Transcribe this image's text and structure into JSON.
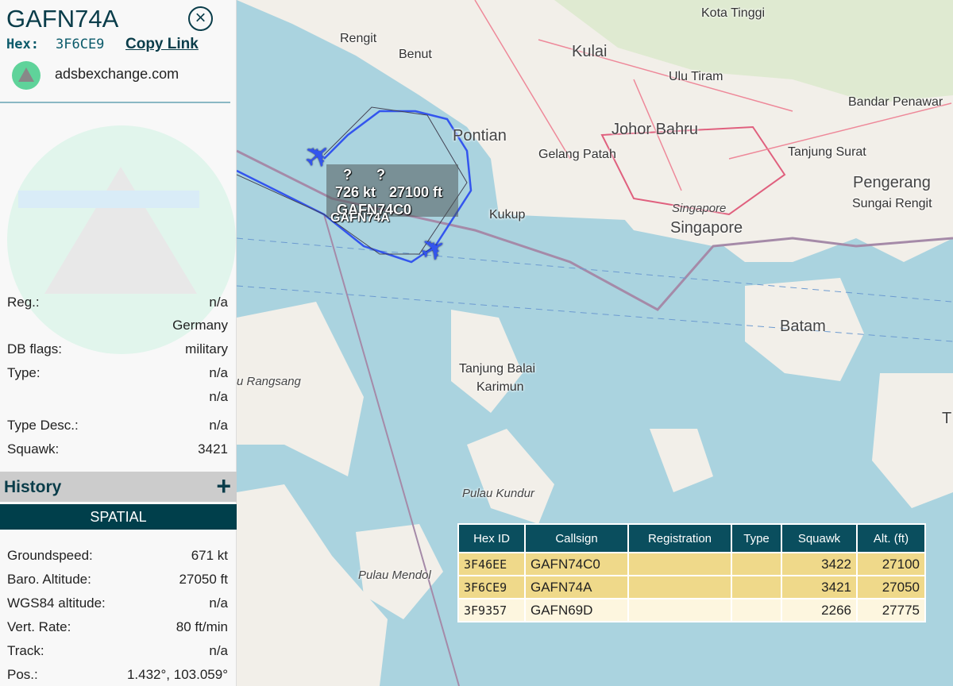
{
  "panel": {
    "callsign": "GAFN74A",
    "hex_label": "Hex:",
    "hex": "3F6CE9",
    "copy_link": "Copy Link",
    "source": "adsbexchange.com",
    "rows1": [
      {
        "k": "Reg.:",
        "v": "n/a"
      },
      {
        "k": "",
        "v": "Germany"
      },
      {
        "k": "DB flags:",
        "v": "military"
      },
      {
        "k": "Type:",
        "v": "n/a"
      },
      {
        "k": "",
        "v": "n/a"
      },
      {
        "k": "Type Desc.:",
        "v": "n/a"
      },
      {
        "k": "Squawk:",
        "v": "3421"
      }
    ],
    "history": "History",
    "history_plus": "+",
    "spatial": "SPATIAL",
    "rows2": [
      {
        "k": "Groundspeed:",
        "v": "671 kt"
      },
      {
        "k": "Baro. Altitude:",
        "v": "27050 ft"
      },
      {
        "k": "WGS84 altitude:",
        "v": "n/a"
      },
      {
        "k": "Vert. Rate:",
        "v": "80 ft/min"
      },
      {
        "k": "Track:",
        "v": "n/a"
      },
      {
        "k": "Pos.:",
        "v": "1.432°, 103.059°"
      }
    ]
  },
  "map": {
    "places": [
      "Kota Tinggi",
      "Rengit",
      "Benut",
      "Kulai",
      "Ulu Tiram",
      "Bandar Penawar",
      "Pontian",
      "Johor Bahru",
      "Gelang Patah",
      "Tanjung Surat",
      "Pengerang",
      "Sungai Rengit",
      "Kukup",
      "Singapore",
      "Singapore",
      "Batam",
      "Tanjung Balai",
      "Karimun",
      "u Rangsang",
      "Pulau Kundur",
      "Pulau Mendol",
      "T"
    ],
    "aircraft_labels": {
      "q1": "?",
      "q2": "?",
      "speed": "726 kt",
      "alt": "27100 ft",
      "callsign1": "GAFN74C0",
      "callsign2": "GAFN74A"
    },
    "track_color": "#3355ee"
  },
  "table": {
    "headers": [
      "Hex ID",
      "Callsign",
      "Registration",
      "Type",
      "Squawk",
      "Alt. (ft)"
    ],
    "rows": [
      [
        "3F46EE",
        "GAFN74C0",
        "",
        "",
        "3422",
        "27100"
      ],
      [
        "3F6CE9",
        "GAFN74A",
        "",
        "",
        "3421",
        "27050"
      ],
      [
        "3F9357",
        "GAFN69D",
        "",
        "",
        "2266",
        "27775"
      ]
    ]
  }
}
